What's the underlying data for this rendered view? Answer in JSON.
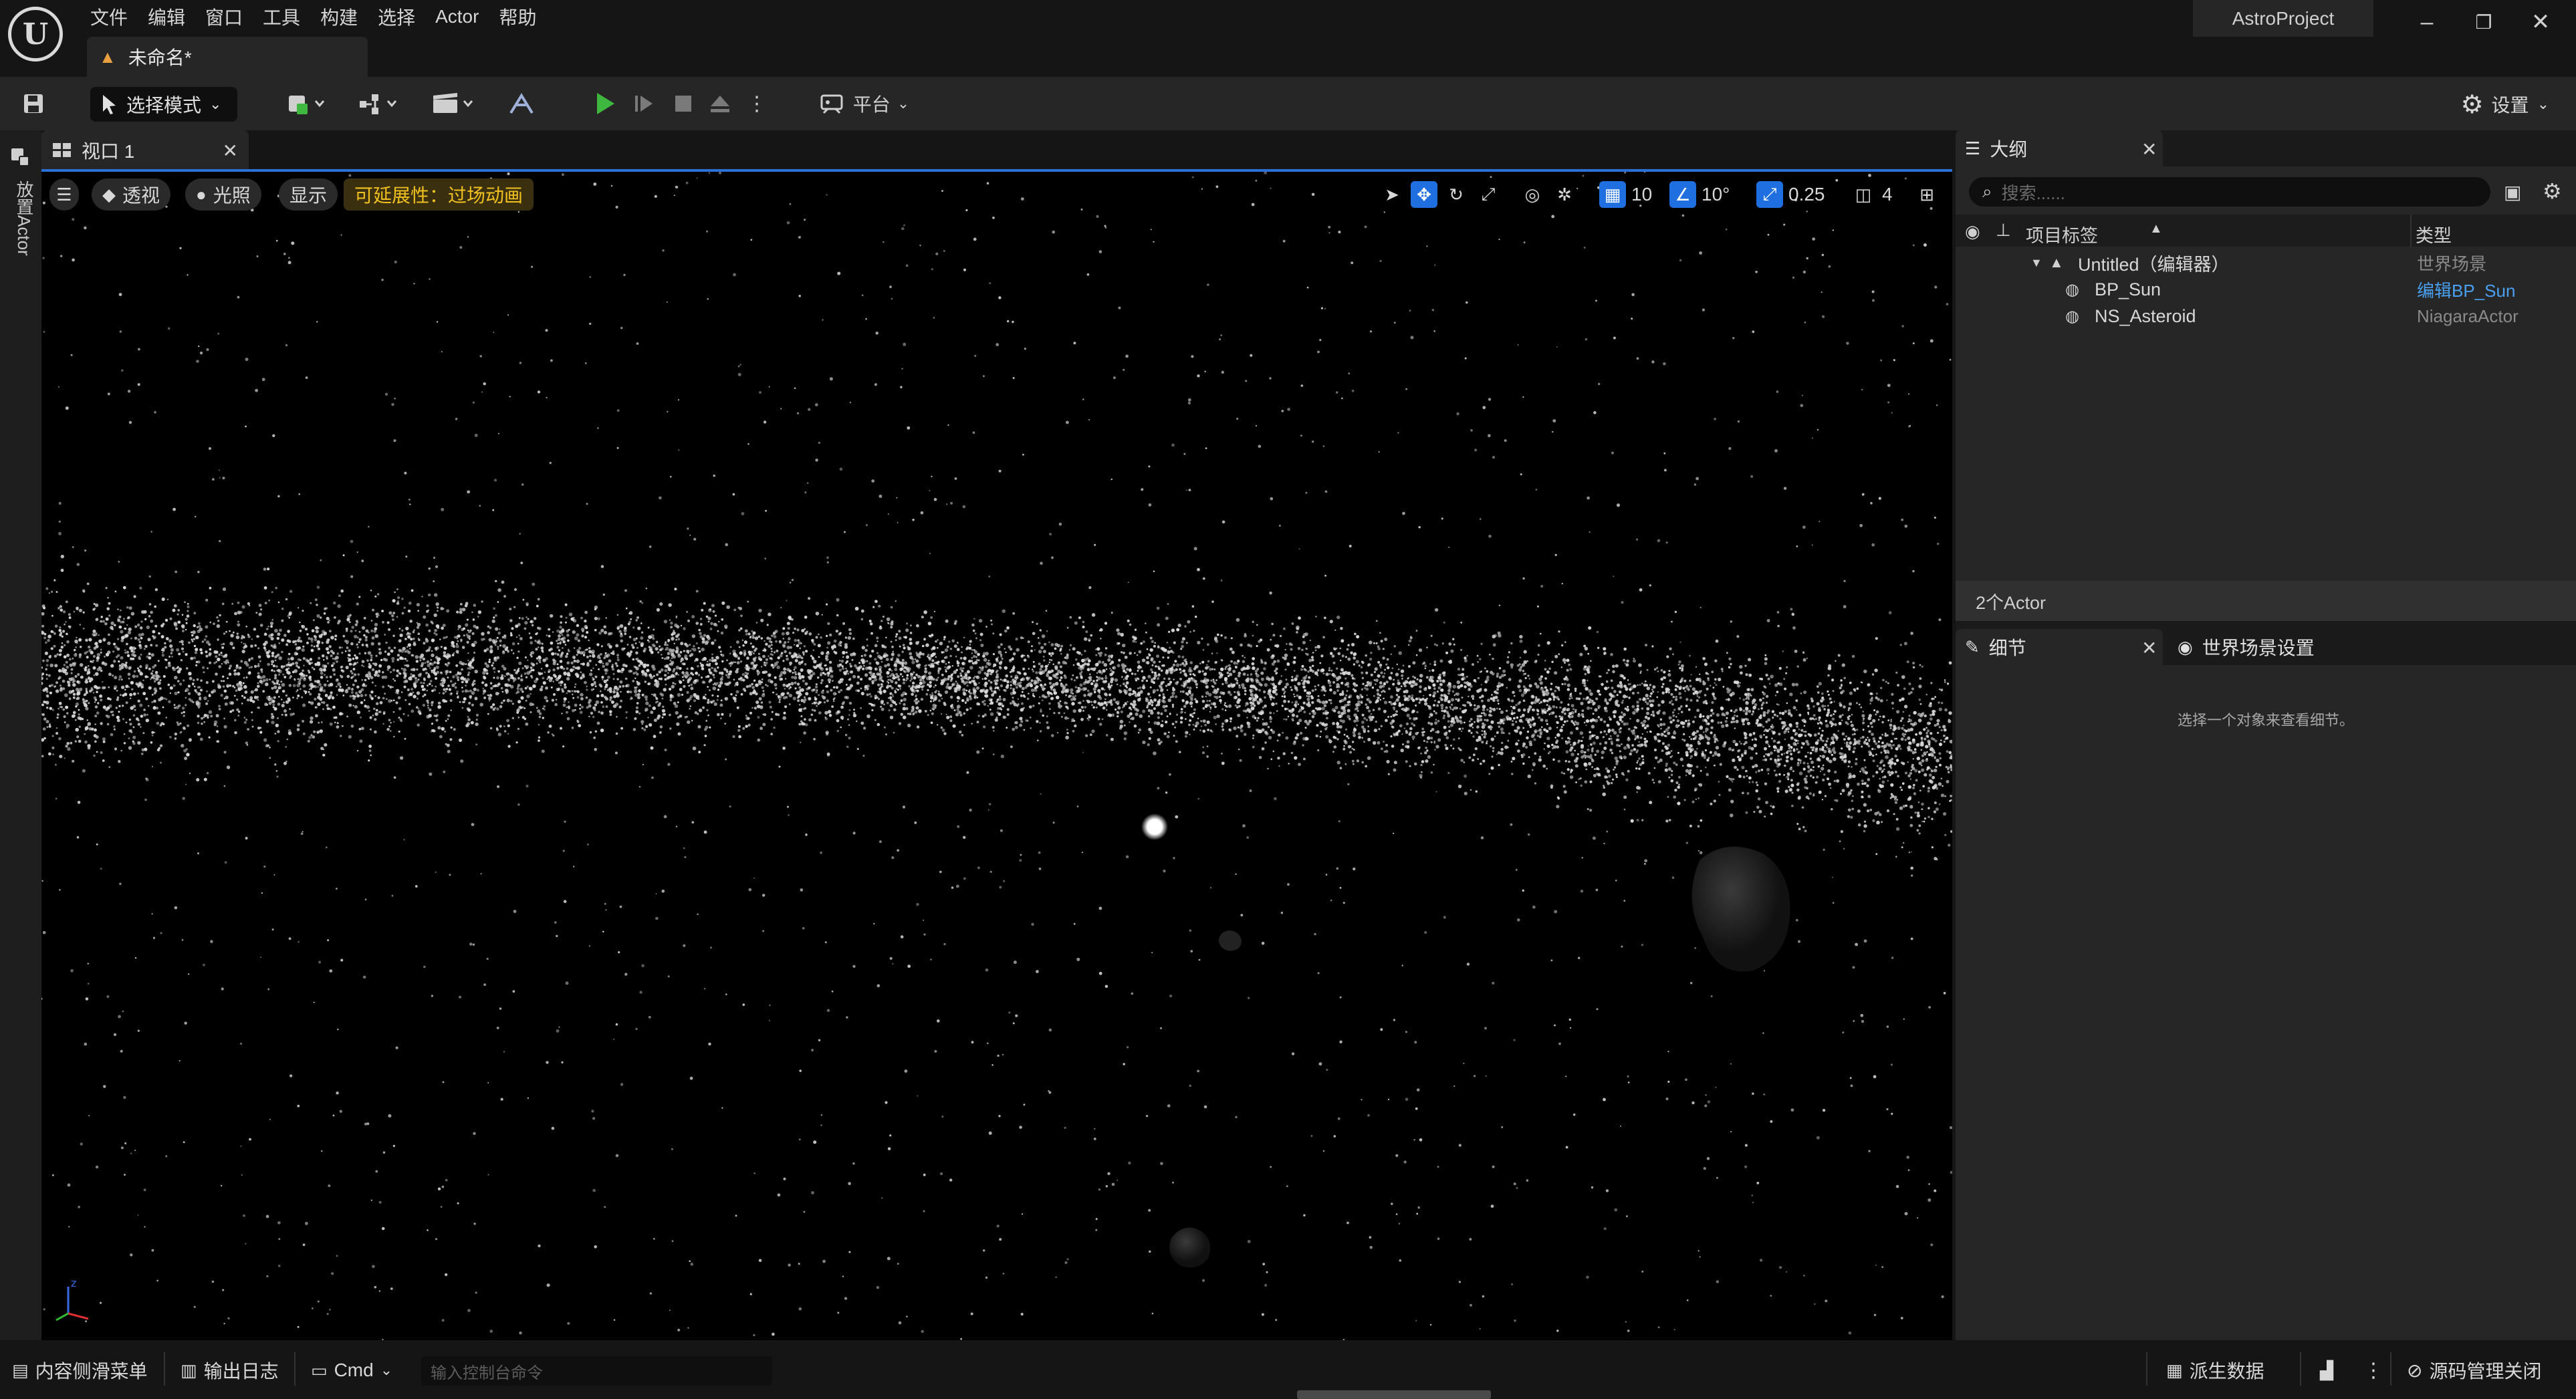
{
  "menu": {
    "items": [
      "文件",
      "编辑",
      "窗口",
      "工具",
      "构建",
      "选择",
      "Actor",
      "帮助"
    ]
  },
  "document_tab": {
    "label": "未命名*"
  },
  "project": {
    "name": "AstroProject"
  },
  "window_controls": {
    "minimize": "–",
    "restore": "❐",
    "close": "✕"
  },
  "toolbar": {
    "mode_label": "选择模式",
    "platform_label": "平台",
    "settings_label": "设置"
  },
  "left_strip": {
    "label": "放置Actor"
  },
  "viewport": {
    "tab_label": "视口 1",
    "perspective_label": "透视",
    "lit_label": "光照",
    "show_label": "显示",
    "scalability_label": "可延展性：过场动画",
    "grid_snap": "10",
    "rotation_snap": "10°",
    "scale_snap": "0.25",
    "camera_speed": "4"
  },
  "outliner": {
    "tab_label": "大纲",
    "search_placeholder": "搜索......",
    "col_label": "项目标签",
    "col_type": "类型",
    "rows": [
      {
        "label": "Untitled（编辑器）",
        "type": "世界场景"
      },
      {
        "label": "BP_Sun",
        "type": "编辑BP_Sun"
      },
      {
        "label": "NS_Asteroid",
        "type": "NiagaraActor"
      }
    ],
    "count": "2个Actor"
  },
  "details": {
    "tab_label": "细节",
    "world_settings_label": "世界场景设置",
    "empty_message": "选择一个对象来查看细节。"
  },
  "status_bar": {
    "content_drawer": "内容侧滑菜单",
    "output_log": "输出日志",
    "cmd_label": "Cmd",
    "console_placeholder": "输入控制台命令",
    "derived_data": "派生数据",
    "source_control": "源码管理关闭"
  },
  "colors": {
    "accent_blue": "#2b6fd8",
    "play_green": "#3fb83f",
    "scalability_yellow": "#f0c020",
    "link_blue": "#4aa0f0"
  }
}
